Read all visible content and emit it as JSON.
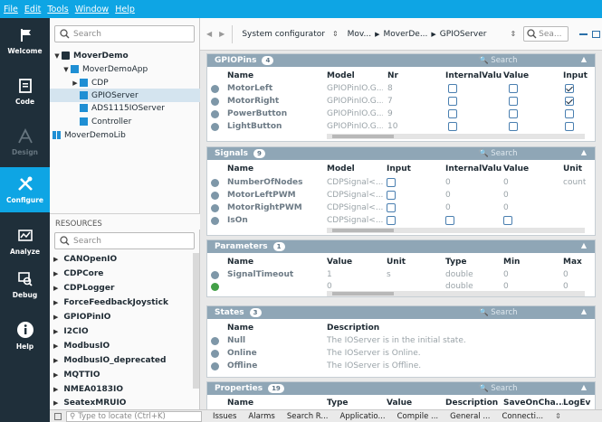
{
  "menu": [
    "File",
    "Edit",
    "Tools",
    "Window",
    "Help"
  ],
  "nav": [
    {
      "label": "Welcome",
      "icon": "flag-icon"
    },
    {
      "label": "Code",
      "icon": "document-icon"
    },
    {
      "label": "Design",
      "icon": "design-icon"
    },
    {
      "label": "Configure",
      "icon": "tools-icon"
    },
    {
      "label": "Analyze",
      "icon": "chart-icon"
    },
    {
      "label": "Debug",
      "icon": "debug-icon"
    },
    {
      "label": "Help",
      "icon": "info-icon"
    }
  ],
  "tree": {
    "search_placeholder": "Search",
    "items": [
      "MoverDemo",
      "MoverDemoApp",
      "CDP",
      "GPIOServer",
      "ADS1115IOServer",
      "Controller",
      "MoverDemoLib"
    ]
  },
  "resources": {
    "title": "RESOURCES",
    "search_placeholder": "Search",
    "items": [
      "CANOpenIO",
      "CDPCore",
      "CDPLogger",
      "ForceFeedbackJoystick",
      "GPIOPinIO",
      "I2CIO",
      "ModbusIO",
      "ModbusIO_deprecated",
      "MQTTIO",
      "NMEA0183IO",
      "SeatexMRUIO"
    ]
  },
  "breadcrumb": {
    "system": "System configurator",
    "parts": [
      "Mov...",
      "MoverDe...",
      "GPIOServer"
    ],
    "search_placeholder": "Sea..."
  },
  "panels": {
    "gpiopins": {
      "title": "GPIOPins",
      "count": "4",
      "search": "Search",
      "headers": [
        "Name",
        "Model",
        "Nr",
        "InternalValue",
        "Value",
        "Input"
      ],
      "rows": [
        {
          "name": "MotorLeft",
          "model": "GPIOPinIO.G...",
          "nr": "8",
          "input": true
        },
        {
          "name": "MotorRight",
          "model": "GPIOPinIO.G...",
          "nr": "7",
          "input": true
        },
        {
          "name": "PowerButton",
          "model": "GPIOPinIO.G...",
          "nr": "9",
          "input": false
        },
        {
          "name": "LightButton",
          "model": "GPIOPinIO.G...",
          "nr": "10",
          "input": false
        }
      ]
    },
    "signals": {
      "title": "Signals",
      "count": "9",
      "search": "Search",
      "headers": [
        "Name",
        "Model",
        "Input",
        "InternalValue",
        "Value",
        "Unit"
      ],
      "rows": [
        {
          "name": "NumberOfNodes",
          "model": "CDPSignal<...",
          "internal": "0",
          "value": "0",
          "unit": "count"
        },
        {
          "name": "MotorLeftPWM",
          "model": "CDPSignal<...",
          "internal": "0",
          "value": "0",
          "unit": ""
        },
        {
          "name": "MotorRightPWM",
          "model": "CDPSignal<...",
          "internal": "0",
          "value": "0",
          "unit": ""
        },
        {
          "name": "IsOn",
          "model": "CDPSignal<...",
          "internal": "",
          "value": "",
          "unit": ""
        }
      ]
    },
    "parameters": {
      "title": "Parameters",
      "count": "1",
      "headers": [
        "Name",
        "Value",
        "Unit",
        "Type",
        "Min",
        "Max"
      ],
      "rows": [
        {
          "name": "SignalTimeout",
          "value": "1",
          "unit": "s",
          "type": "double",
          "min": "0",
          "max": "0"
        },
        {
          "name": "",
          "value": "0",
          "unit": "",
          "type": "double",
          "min": "0",
          "max": "0"
        }
      ]
    },
    "states": {
      "title": "States",
      "count": "3",
      "search": "Search",
      "headers": [
        "Name",
        "Description"
      ],
      "rows": [
        {
          "name": "Null",
          "desc": "The IOServer is in the initial state."
        },
        {
          "name": "Online",
          "desc": "The IOServer is Online."
        },
        {
          "name": "Offline",
          "desc": "The IOServer is Offline."
        }
      ]
    },
    "properties": {
      "title": "Properties",
      "count": "19",
      "search": "Search",
      "headers": [
        "Name",
        "Type",
        "Value",
        "Description",
        "SaveOnCha...",
        "LogEv"
      ]
    }
  },
  "bottom": {
    "locate_placeholder": "Type to locate (Ctrl+K)",
    "tabs": [
      "Issues",
      "Alarms",
      "Search R...",
      "Applicatio...",
      "Compile ...",
      "General ...",
      "Connecti..."
    ]
  }
}
